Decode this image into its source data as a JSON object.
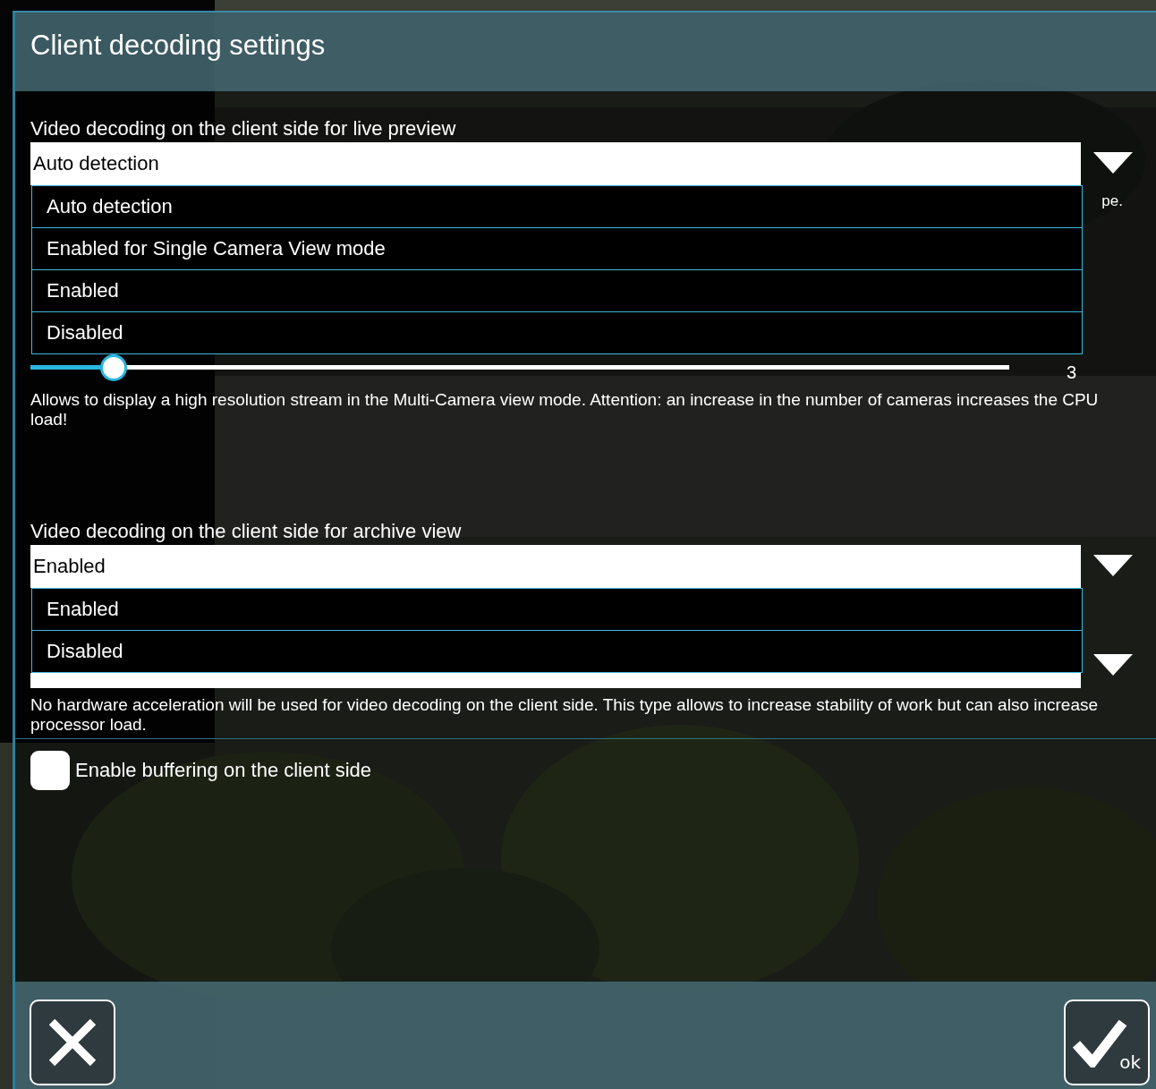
{
  "dialog": {
    "title": "Client decoding settings"
  },
  "live_preview": {
    "label": "Video decoding on the client side for live preview",
    "value": "Auto detection",
    "expanded": true,
    "options": [
      {
        "label": "Auto detection"
      },
      {
        "label": "Enabled for Single Camera View mode"
      },
      {
        "label": "Enabled"
      },
      {
        "label": "Disabled"
      }
    ],
    "covered_hint_tail": "pe.",
    "slider": {
      "level": 0.084,
      "reading": "3"
    },
    "description": "Allows to display a high resolution stream in the Multi-Camera view mode. Attention: an increase in the number of cameras increases the CPU load!"
  },
  "archive_view": {
    "label": "Video decoding on the client side for archive view",
    "value": "Enabled",
    "expanded": true,
    "options": [
      {
        "label": "Enabled"
      },
      {
        "label": "Disabled"
      }
    ],
    "description": "No hardware acceleration will be used for video decoding on the client side. This type allows to increase stability of work but can also increase processor load."
  },
  "buffering": {
    "label": "Enable buffering on the client side",
    "checked": false
  },
  "footer": {
    "ok_label": "ok"
  }
}
